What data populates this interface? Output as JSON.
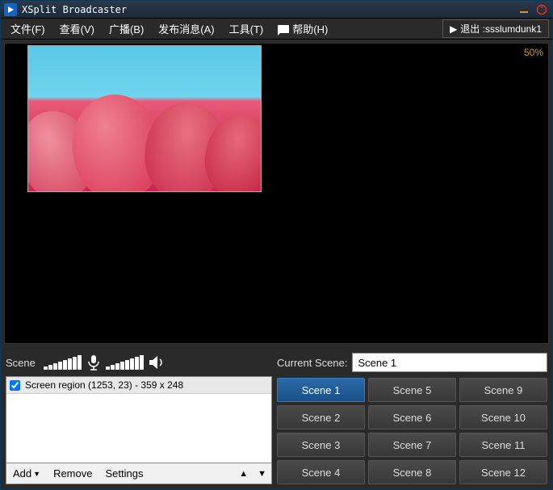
{
  "titlebar": {
    "title": "XSplit Broadcaster"
  },
  "menu": {
    "file": "文件(F)",
    "view": "查看(V)",
    "broadcast": "广播(B)",
    "publish": "发布消息(A)",
    "tools": "工具(T)",
    "help": "帮助(H)"
  },
  "user": {
    "logout_prefix": "退出 : ",
    "username": "ssslumdunk1"
  },
  "preview": {
    "zoom": "50%"
  },
  "left": {
    "scene_label": "Scene",
    "source_item": "Screen region (1253, 23) - 359 x 248",
    "add": "Add",
    "remove": "Remove",
    "settings": "Settings"
  },
  "right": {
    "current_label": "Current Scene:",
    "current_value": "Scene 1",
    "scenes": [
      "Scene 1",
      "Scene 2",
      "Scene 3",
      "Scene 4",
      "Scene 5",
      "Scene 6",
      "Scene 7",
      "Scene 8",
      "Scene 9",
      "Scene 10",
      "Scene 11",
      "Scene 12"
    ],
    "active_index": 0
  }
}
